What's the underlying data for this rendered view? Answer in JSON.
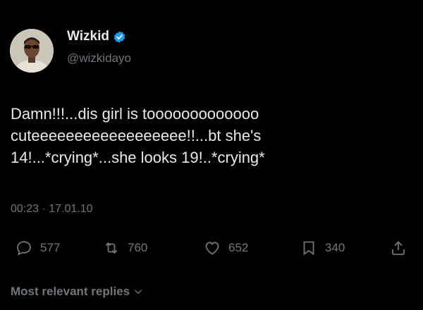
{
  "colors": {
    "background": "#000000",
    "primary_text": "#e7e9ea",
    "secondary_text": "#71767b",
    "verified_badge": "#1d9bf0"
  },
  "author": {
    "display_name": "Wizkid",
    "handle": "@wizkidayo",
    "verified": true
  },
  "tweet": {
    "text": "Damn!!!...dis girl is tooooooooooooo\ncuteeeeeeeeeeeeeeeeee!!...bt she's\n14!...*crying*...she looks 19!..*crying*",
    "time": "00:23",
    "separator": "·",
    "date": "17.01.10"
  },
  "actions": {
    "replies": {
      "icon": "reply-icon",
      "count": "577"
    },
    "retweets": {
      "icon": "retweet-icon",
      "count": "760"
    },
    "likes": {
      "icon": "heart-icon",
      "count": "652"
    },
    "bookmarks": {
      "icon": "bookmark-icon",
      "count": "340"
    },
    "share": {
      "icon": "share-icon"
    }
  },
  "replies_section": {
    "label": "Most relevant replies",
    "icon": "chevron-down-icon"
  }
}
